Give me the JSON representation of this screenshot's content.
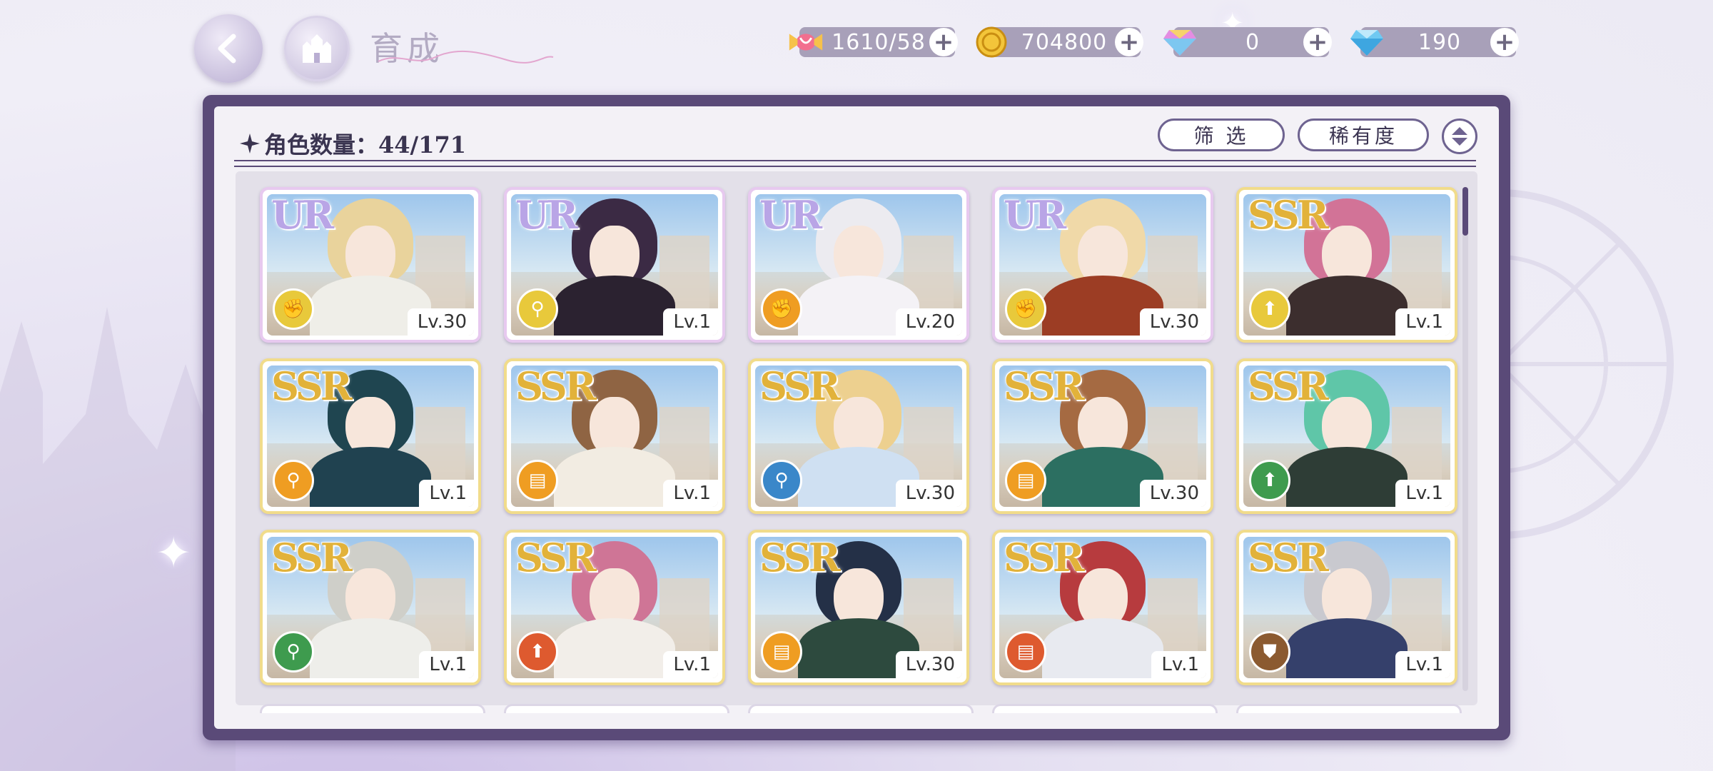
{
  "header": {
    "title": "育成",
    "resources": [
      {
        "name": "candy",
        "value": "1610/58",
        "icon": "candy-icon"
      },
      {
        "name": "gold",
        "value": "704800",
        "icon": "gold-coin-icon"
      },
      {
        "name": "rainbow-gem",
        "value": "0",
        "icon": "rainbow-gem-icon"
      },
      {
        "name": "diamond",
        "value": "190",
        "icon": "diamond-icon"
      }
    ],
    "plus_label": "+"
  },
  "toolbar": {
    "count_label": "角色数量：44/171",
    "filter_label": "筛 选",
    "rarity_label": "稀有度"
  },
  "cards": [
    {
      "rarity": "UR",
      "level": "Lv.30",
      "type_color": "#e8c93b",
      "type": "fist-icon",
      "hair": "#e9d39c",
      "outfit": "#efeee8"
    },
    {
      "rarity": "UR",
      "level": "Lv.1",
      "type_color": "#e8c93b",
      "type": "staff-icon",
      "hair": "#3b2a44",
      "outfit": "#2b2230"
    },
    {
      "rarity": "UR",
      "level": "Lv.20",
      "type_color": "#ef9d22",
      "type": "fist-icon",
      "hair": "#ecebf0",
      "outfit": "#f4f2f6"
    },
    {
      "rarity": "UR",
      "level": "Lv.30",
      "type_color": "#e8c93b",
      "type": "fist-icon",
      "hair": "#f0d9a8",
      "outfit": "#9c3d24"
    },
    {
      "rarity": "SSR",
      "level": "Lv.1",
      "type_color": "#e8c93b",
      "type": "boot-icon",
      "hair": "#d27397",
      "outfit": "#3c2e2e"
    },
    {
      "rarity": "SSR",
      "level": "Lv.1",
      "type_color": "#ef9d22",
      "type": "staff-icon",
      "hair": "#1f4550",
      "outfit": "#204250"
    },
    {
      "rarity": "SSR",
      "level": "Lv.1",
      "type_color": "#ef9d22",
      "type": "book-icon",
      "hair": "#8f6443",
      "outfit": "#f2ece2"
    },
    {
      "rarity": "SSR",
      "level": "Lv.30",
      "type_color": "#3a87c9",
      "type": "staff-icon",
      "hair": "#edd08f",
      "outfit": "#cfe0f2"
    },
    {
      "rarity": "SSR",
      "level": "Lv.30",
      "type_color": "#ef9d22",
      "type": "book-icon",
      "hair": "#a56a42",
      "outfit": "#2c6f61"
    },
    {
      "rarity": "SSR",
      "level": "Lv.1",
      "type_color": "#3e9b4e",
      "type": "boot-icon",
      "hair": "#5fc6a8",
      "outfit": "#2e3d36"
    },
    {
      "rarity": "SSR",
      "level": "Lv.1",
      "type_color": "#3e9b4e",
      "type": "staff-icon",
      "hair": "#cfcfc9",
      "outfit": "#eeeeea"
    },
    {
      "rarity": "SSR",
      "level": "Lv.1",
      "type_color": "#de5a2f",
      "type": "boot-icon",
      "hair": "#cf7596",
      "outfit": "#f2eee9"
    },
    {
      "rarity": "SSR",
      "level": "Lv.30",
      "type_color": "#ef9d22",
      "type": "book-icon",
      "hair": "#243047",
      "outfit": "#2d4a3e"
    },
    {
      "rarity": "SSR",
      "level": "Lv.1",
      "type_color": "#de5a2f",
      "type": "book-icon",
      "hair": "#b73b3e",
      "outfit": "#e8eaf0"
    },
    {
      "rarity": "SSR",
      "level": "Lv.1",
      "type_color": "#8b5a30",
      "type": "shield-icon",
      "hair": "#c9c9cf",
      "outfit": "#35406b"
    }
  ]
}
